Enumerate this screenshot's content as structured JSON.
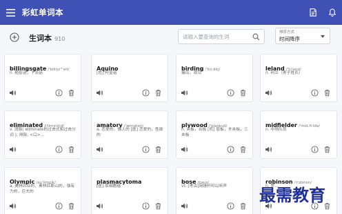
{
  "app": {
    "title": "彩虹单词本"
  },
  "toolbar": {
    "vocab_title": "生词本",
    "vocab_count": "910",
    "search_placeholder": "请输入要查询的生词",
    "sort_label": "排序方式",
    "sort_value": "时间降序"
  },
  "cards": [
    {
      "word": "billingsgate",
      "phonetic": "/'biliŋz^eit/",
      "definition": "n. 粗俗话，下流话"
    },
    {
      "word": "Aquino",
      "phonetic": "",
      "definition": "[姓] 阿奎诺"
    },
    {
      "word": "birding",
      "phonetic": "/'bɜ:diŋ/",
      "definition": "捕鸟，观鸟"
    },
    {
      "word": "leland",
      "phonetic": "/'li:land/",
      "definition": "n. 利兰（男子姓氏）"
    },
    {
      "word": "eliminated",
      "phonetic": "/i'liminitid/",
      "definition": "v. 消除( eliminate的过去式和过去分词 ); 排除; <口>..."
    },
    {
      "word": "amatory",
      "phonetic": "/'æmətəri/",
      "definition": "a. 恋爱的，情人的 [医] 恋爱的，性欲的"
    },
    {
      "word": "plywood",
      "phonetic": "/'plaiwud/",
      "definition": "n. 夹板，合板 [机] 层板，木夹板，三夹板"
    },
    {
      "word": "midfielder",
      "phonetic": "/'mid.fi:ldə/",
      "definition": "n. 中场队员"
    },
    {
      "word": "Olympic",
      "phonetic": "/əu'limpik/",
      "definition": "a. 奥林匹亚的，奥林匹斯山的，强有力的，巨大的"
    },
    {
      "word": "plasmacytoma",
      "phonetic": "",
      "definition": "[医] 浆细胞瘤"
    },
    {
      "word": "bose",
      "phonetic": "/bəus/",
      "definition": "vt. [考古]用锤杆叩以听声"
    },
    {
      "word": "robinson",
      "phonetic": "/'rɔbinsn/",
      "definition": "n. 罗..."
    }
  ],
  "watermark": "最需教育"
}
